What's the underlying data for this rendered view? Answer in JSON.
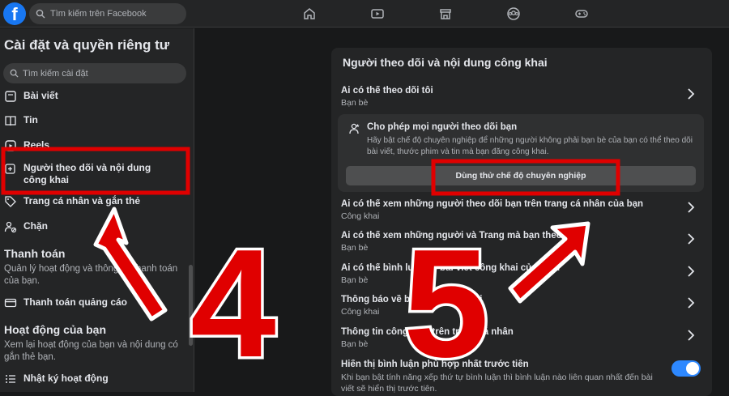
{
  "topbar": {
    "logo": "f",
    "search_placeholder": "Tìm kiếm trên Facebook",
    "nav_icons": [
      "home-icon",
      "video-icon",
      "marketplace-icon",
      "groups-icon",
      "gaming-icon"
    ]
  },
  "sidebar": {
    "title": "Cài đặt và quyền riêng tư",
    "search_placeholder": "Tìm kiếm cài đặt",
    "items": [
      {
        "label": "Bài viết",
        "icon": "posts-icon"
      },
      {
        "label": "Tin",
        "icon": "stories-icon"
      },
      {
        "label": "Reels",
        "icon": "reels-icon"
      },
      {
        "label": "Người theo dõi và nội dung công khai",
        "icon": "followers-icon"
      },
      {
        "label": "Trang cá nhân và gắn thẻ",
        "icon": "tag-icon"
      },
      {
        "label": "Chặn",
        "icon": "block-user-icon"
      }
    ],
    "payments": {
      "title": "Thanh toán",
      "desc": "Quản lý hoạt động và thông tin thanh toán của bạn.",
      "item": "Thanh toán quảng cáo"
    },
    "activity": {
      "title": "Hoạt động của bạn",
      "desc": "Xem lại hoạt động của bạn và nội dung có gắn thẻ bạn.",
      "item": "Nhật ký hoạt động"
    }
  },
  "panel": {
    "title": "Người theo dõi và nội dung công khai",
    "rows": [
      {
        "title": "Ai có thể theo dõi tôi",
        "value": "Bạn bè"
      },
      {
        "title": "Ai có thể xem những người theo dõi bạn trên trang cá nhân của bạn",
        "value": "Công khai"
      },
      {
        "title": "Ai có thể xem những người và Trang mà bạn theo dõi?",
        "value": "Bạn bè"
      },
      {
        "title": "Ai có thể bình luận về bài viết công khai của bạn?",
        "value": "Bạn bè"
      },
      {
        "title": "Thông báo về bài viết công khai",
        "value": "Công khai"
      },
      {
        "title": "Thông tin công khai trên trang cá nhân",
        "value": "Bạn bè"
      }
    ],
    "promo": {
      "title": "Cho phép mọi người theo dõi bạn",
      "desc": "Hãy bật chế độ chuyên nghiệp để những người không phải bạn bè của bạn có thể theo dõi bài viết, thước phim và tin mà bạn đăng công khai.",
      "button": "Dùng thử chế độ chuyên nghiệp"
    },
    "toggle_row": {
      "title": "Hiển thị bình luận phù hợp nhất trước tiên",
      "desc": "Khi bạn bật tính năng xếp thứ tự bình luận thì bình luận nào liên quan nhất đến bài viết sẽ hiển thị trước tiên.",
      "on": true
    }
  },
  "annotations": {
    "left_number": "4",
    "right_number": "5",
    "color": "#e00000"
  }
}
